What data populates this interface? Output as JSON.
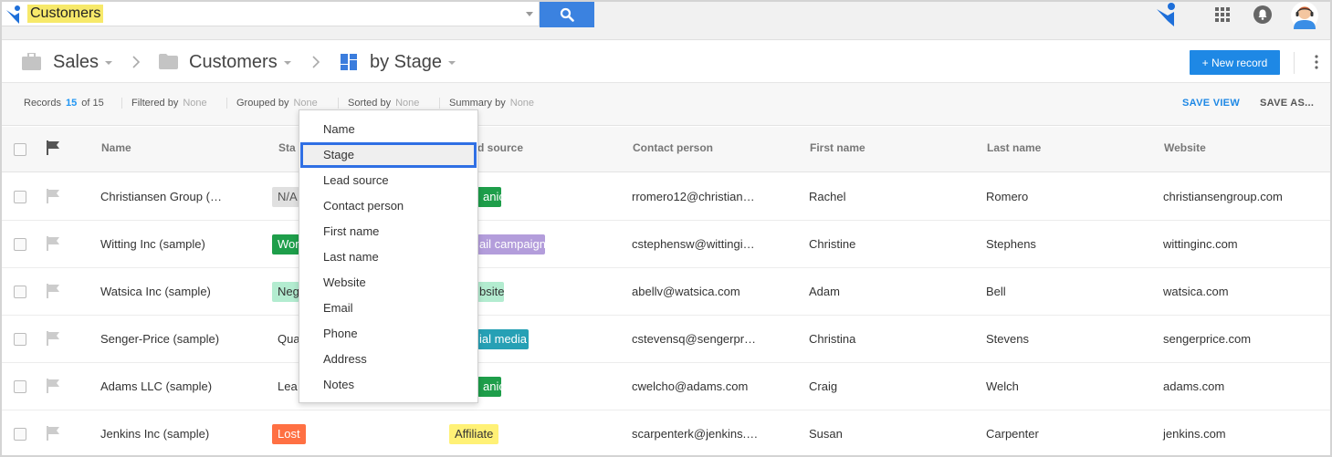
{
  "topbar": {
    "search_value": "Customers"
  },
  "breadcrumb": {
    "app": "Sales",
    "table": "Customers",
    "view": "by Stage"
  },
  "header": {
    "new_record_label": "+ New record"
  },
  "records_bar": {
    "records_label": "Records",
    "records_count": "15",
    "records_total": "of 15",
    "filtered_label": "Filtered by",
    "filtered_value": "None",
    "grouped_label": "Grouped by",
    "grouped_value": "None",
    "sorted_label": "Sorted by",
    "sorted_value": "None",
    "summary_label": "Summary by",
    "summary_value": "None",
    "save_view": "SAVE VIEW",
    "save_as": "SAVE AS..."
  },
  "columns": [
    "Name",
    "Sta",
    "d source",
    "Contact person",
    "First name",
    "Last name",
    "Website"
  ],
  "rows": [
    {
      "name": "Christiansen Group (…",
      "stage": "N/A",
      "lead": "anic",
      "contact": "rromero12@christian…",
      "first": "Rachel",
      "last": "Romero",
      "website": "christiansengroup.com"
    },
    {
      "name": "Witting Inc (sample)",
      "stage": "Wor",
      "lead": "ail campaign",
      "contact": "cstephensw@wittingi…",
      "first": "Christine",
      "last": "Stephens",
      "website": "wittinginc.com"
    },
    {
      "name": "Watsica Inc (sample)",
      "stage": "Neg",
      "lead": "bsite",
      "contact": "abellv@watsica.com",
      "first": "Adam",
      "last": "Bell",
      "website": "watsica.com"
    },
    {
      "name": "Senger-Price (sample)",
      "stage": "Qua",
      "lead": "ial media",
      "contact": "cstevensq@sengerpr…",
      "first": "Christina",
      "last": "Stevens",
      "website": "sengerprice.com"
    },
    {
      "name": "Adams LLC (sample)",
      "stage": "Lea",
      "lead": "anic",
      "contact": "cwelcho@adams.com",
      "first": "Craig",
      "last": "Welch",
      "website": "adams.com"
    },
    {
      "name": "Jenkins Inc (sample)",
      "stage": "Lost",
      "lead": "Affiliate",
      "contact": "scarpenterk@jenkins.…",
      "first": "Susan",
      "last": "Carpenter",
      "website": "jenkins.com"
    }
  ],
  "colors": {
    "accent": "#1e88e5",
    "stage_na": "#e0e0e0",
    "stage_won": "#1e9e4a",
    "stage_negotiation": "#b3ecd0",
    "stage_lost": "#ff7043",
    "lead_organic": "#1e9e4a",
    "lead_email": "#b39ddb",
    "lead_website": "#b3ecd0",
    "lead_social": "#26a0b5",
    "lead_affiliate": "#fff176"
  },
  "dropdown": {
    "items": [
      "Name",
      "Stage",
      "Lead source",
      "Contact person",
      "First name",
      "Last name",
      "Website",
      "Email",
      "Phone",
      "Address",
      "Notes"
    ],
    "selected": "Stage"
  }
}
